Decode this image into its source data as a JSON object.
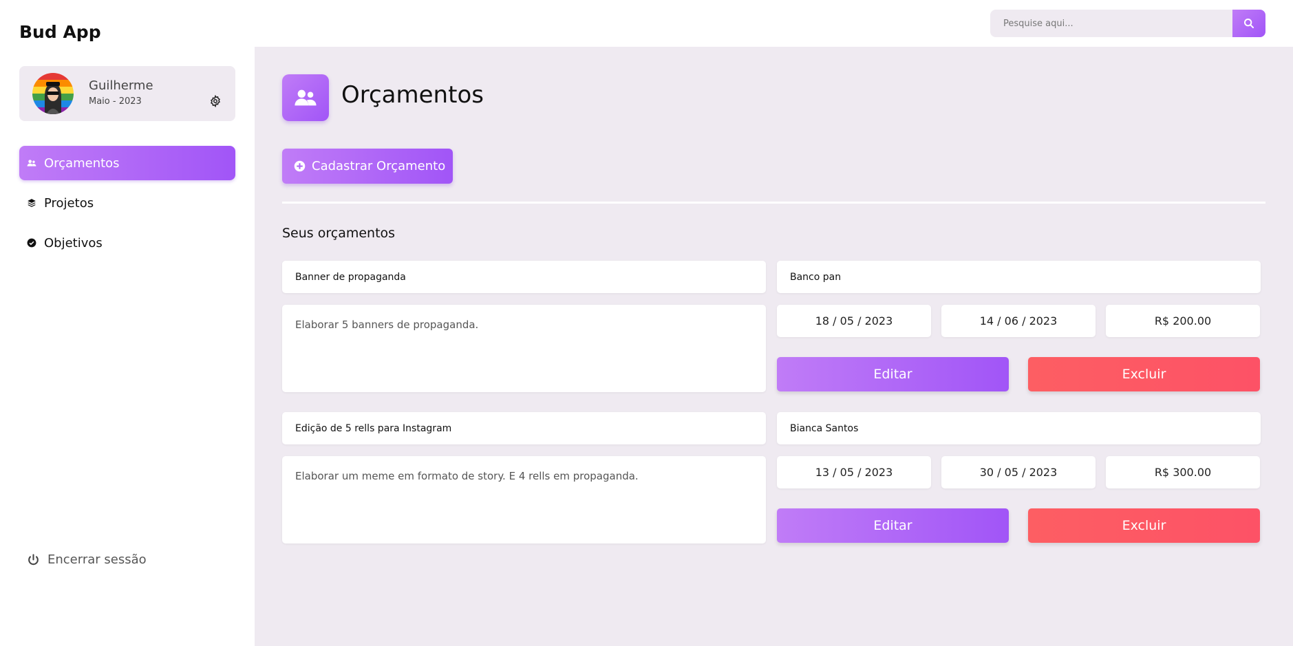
{
  "app": {
    "brand": "Bud App"
  },
  "profile": {
    "name": "Guilherme",
    "date": "Maio - 2023"
  },
  "nav": [
    {
      "label": "Orçamentos",
      "icon": "users-icon",
      "active": true
    },
    {
      "label": "Projetos",
      "icon": "layers-icon",
      "active": false
    },
    {
      "label": "Objetivos",
      "icon": "check-circle-icon",
      "active": false
    }
  ],
  "logout": {
    "label": "Encerrar sessão",
    "icon": "power-icon"
  },
  "search": {
    "placeholder": "Pesquise aqui...",
    "value": ""
  },
  "page": {
    "title": "Orçamentos",
    "add_button": "Cadastrar Orçamento",
    "section_title": "Seus orçamentos"
  },
  "colors": {
    "accent_start": "#c07cf7",
    "accent_end": "#a155f7",
    "danger": "#fd5864",
    "background": "#efeaf1"
  },
  "budgets": [
    {
      "title": "Banner de propaganda",
      "client": "Banco pan",
      "description": "Elaborar 5 banners de propaganda.",
      "start_date": "18 / 05 / 2023",
      "end_date": "14 / 06 / 2023",
      "price": "R$ 200.00",
      "edit_label": "Editar",
      "delete_label": "Excluir"
    },
    {
      "title": "Edição de 5 rells para Instagram",
      "client": "Bianca Santos",
      "description": "Elaborar um meme em formato de story. E 4 rells em propaganda.",
      "start_date": "13 / 05 / 2023",
      "end_date": "30 / 05 / 2023",
      "price": "R$ 300.00",
      "edit_label": "Editar",
      "delete_label": "Excluir"
    }
  ]
}
